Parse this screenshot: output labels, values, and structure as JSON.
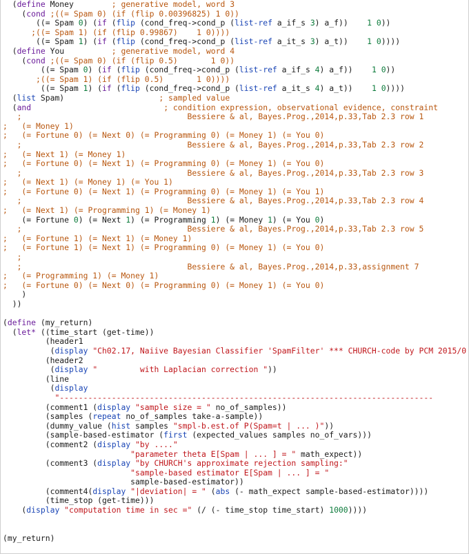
{
  "editor": {
    "colors": {
      "plain": "#1a1a1a",
      "keyword": "#6a1b9a",
      "comment": "#b8560e",
      "string": "#c0161b",
      "number": "#0b7a3a",
      "builtin": "#1a45b5"
    },
    "lines": [
      [
        [
          "  (",
          "plain"
        ],
        [
          "define",
          "kw"
        ],
        [
          " Money        ",
          "plain"
        ],
        [
          "; generative model, word 3",
          "com"
        ]
      ],
      [
        [
          "    (",
          "plain"
        ],
        [
          "cond",
          "kw"
        ],
        [
          " ",
          "plain"
        ],
        [
          ";((= Spam 0) (if (flip 0.00396825) 1 0))",
          "com"
        ]
      ],
      [
        [
          "       ((= Spam ",
          "plain"
        ],
        [
          "0",
          "num"
        ],
        [
          ") (",
          "plain"
        ],
        [
          "if",
          "kw"
        ],
        [
          " (",
          "plain"
        ],
        [
          "flip",
          "fn"
        ],
        [
          " (cond_freq->cond_p (",
          "plain"
        ],
        [
          "list-ref",
          "fn"
        ],
        [
          " a_if_s ",
          "plain"
        ],
        [
          "3",
          "num"
        ],
        [
          ") a_f))    ",
          "plain"
        ],
        [
          "1",
          "num"
        ],
        [
          " ",
          "plain"
        ],
        [
          "0",
          "num"
        ],
        [
          "))",
          "plain"
        ]
      ],
      [
        [
          "      ",
          "plain"
        ],
        [
          ";((= Spam 1) (if (flip 0.99867)    1 0))))",
          "com"
        ]
      ],
      [
        [
          "       ((= Spam ",
          "plain"
        ],
        [
          "1",
          "num"
        ],
        [
          ") (",
          "plain"
        ],
        [
          "if",
          "kw"
        ],
        [
          " (",
          "plain"
        ],
        [
          "flip",
          "fn"
        ],
        [
          " (cond_freq->cond_p (",
          "plain"
        ],
        [
          "list-ref",
          "fn"
        ],
        [
          " a_it_s ",
          "plain"
        ],
        [
          "3",
          "num"
        ],
        [
          ") a_t))    ",
          "plain"
        ],
        [
          "1",
          "num"
        ],
        [
          " ",
          "plain"
        ],
        [
          "0",
          "num"
        ],
        [
          "))))",
          "plain"
        ]
      ],
      [
        [
          "  (",
          "plain"
        ],
        [
          "define",
          "kw"
        ],
        [
          " You          ",
          "plain"
        ],
        [
          "; generative model, word 4",
          "com"
        ]
      ],
      [
        [
          "    (",
          "plain"
        ],
        [
          "cond",
          "kw"
        ],
        [
          " ",
          "plain"
        ],
        [
          ";((= Spam 0) (if (flip 0.5)       1 0))",
          "com"
        ]
      ],
      [
        [
          "        ((= Spam ",
          "plain"
        ],
        [
          "0",
          "num"
        ],
        [
          ") (",
          "plain"
        ],
        [
          "if",
          "kw"
        ],
        [
          " (",
          "plain"
        ],
        [
          "flip",
          "fn"
        ],
        [
          " (cond_freq->cond_p (",
          "plain"
        ],
        [
          "list-ref",
          "fn"
        ],
        [
          " a_if_s ",
          "plain"
        ],
        [
          "4",
          "num"
        ],
        [
          ") a_f))    ",
          "plain"
        ],
        [
          "1",
          "num"
        ],
        [
          " ",
          "plain"
        ],
        [
          "0",
          "num"
        ],
        [
          "))",
          "plain"
        ]
      ],
      [
        [
          "       ",
          "plain"
        ],
        [
          ";((= Spam 1) (if (flip 0.5)       1 0))))",
          "com"
        ]
      ],
      [
        [
          "        ((= Spam ",
          "plain"
        ],
        [
          "1",
          "num"
        ],
        [
          ") (",
          "plain"
        ],
        [
          "if",
          "kw"
        ],
        [
          " (",
          "plain"
        ],
        [
          "flip",
          "fn"
        ],
        [
          " (cond_freq->cond_p (",
          "plain"
        ],
        [
          "list-ref",
          "fn"
        ],
        [
          " a_it_s ",
          "plain"
        ],
        [
          "4",
          "num"
        ],
        [
          ") a_t))    ",
          "plain"
        ],
        [
          "1",
          "num"
        ],
        [
          " ",
          "plain"
        ],
        [
          "0",
          "num"
        ],
        [
          "))))",
          "plain"
        ]
      ],
      [
        [
          "  (",
          "plain"
        ],
        [
          "list",
          "fn"
        ],
        [
          " Spam)                    ",
          "plain"
        ],
        [
          "; sampled value",
          "com"
        ]
      ],
      [
        [
          "  (",
          "plain"
        ],
        [
          "and",
          "kw"
        ],
        [
          "                            ",
          "plain"
        ],
        [
          "; condition expression, observational evidence, constraint",
          "com"
        ]
      ],
      [
        [
          "   ",
          "plain"
        ],
        [
          ";                                   Bessiere & al, Bayes.Prog.,2014,p.33,Tab 2.3 row 1",
          "com"
        ]
      ],
      [
        [
          ";   (= Money 1)",
          "com"
        ]
      ],
      [
        [
          ";   (= Fortune 0) (= Next 0) (= Programming 0) (= Money 1) (= You 0)",
          "com"
        ]
      ],
      [
        [
          "   ",
          "plain"
        ],
        [
          ";                                   Bessiere & al, Bayes.Prog.,2014,p.33,Tab 2.3 row 2",
          "com"
        ]
      ],
      [
        [
          ";   (= Next 1) (= Money 1)",
          "com"
        ]
      ],
      [
        [
          ";   (= Fortune 0) (= Next 1) (= Programming 0) (= Money 1) (= You 0)",
          "com"
        ]
      ],
      [
        [
          "   ",
          "plain"
        ],
        [
          ";                                   Bessiere & al, Bayes.Prog.,2014,p.33,Tab 2.3 row 3",
          "com"
        ]
      ],
      [
        [
          ";   (= Next 1) (= Money 1) (= You 1)",
          "com"
        ]
      ],
      [
        [
          ";   (= Fortune 0) (= Next 1) (= Programming 0) (= Money 1) (= You 1)",
          "com"
        ]
      ],
      [
        [
          "   ",
          "plain"
        ],
        [
          ";                                   Bessiere & al, Bayes.Prog.,2014,p.33,Tab 2.3 row 4",
          "com"
        ]
      ],
      [
        [
          ";   (= Next 1) (= Programming 1) (= Money 1)",
          "com"
        ]
      ],
      [
        [
          "    (= Fortune ",
          "plain"
        ],
        [
          "0",
          "num"
        ],
        [
          ") (= Next ",
          "plain"
        ],
        [
          "1",
          "num"
        ],
        [
          ") (= Programming ",
          "plain"
        ],
        [
          "1",
          "num"
        ],
        [
          ") (= Money ",
          "plain"
        ],
        [
          "1",
          "num"
        ],
        [
          ") (= You ",
          "plain"
        ],
        [
          "0",
          "num"
        ],
        [
          ")",
          "plain"
        ]
      ],
      [
        [
          "   ",
          "plain"
        ],
        [
          ";                                   Bessiere & al, Bayes.Prog.,2014,p.33,Tab 2.3 row 5",
          "com"
        ]
      ],
      [
        [
          ";   (= Fortune 1) (= Next 1) (= Money 1)",
          "com"
        ]
      ],
      [
        [
          ";   (= Fortune 1) (= Next 1) (= Programming 0) (= Money 1) (= You 0)",
          "com"
        ]
      ],
      [
        [
          "   ",
          "plain"
        ],
        [
          ";",
          "com"
        ]
      ],
      [
        [
          "   ",
          "plain"
        ],
        [
          ";                                   Bessiere & al, Bayes.Prog.,2014,p.33,assignment 7",
          "com"
        ]
      ],
      [
        [
          ";   (= Programming 1) (= Money 1)",
          "com"
        ]
      ],
      [
        [
          ";   (= Fortune 0) (= Next 0) (= Programming 0) (= Money 1) (= You 0)",
          "com"
        ]
      ],
      [
        [
          "    )",
          "plain"
        ]
      ],
      [
        [
          "  ))",
          "plain"
        ]
      ],
      [
        [
          "",
          "plain"
        ]
      ],
      [
        [
          "(",
          "plain"
        ],
        [
          "define",
          "kw"
        ],
        [
          " (my_return)",
          "plain"
        ]
      ],
      [
        [
          "  (",
          "plain"
        ],
        [
          "let*",
          "kw"
        ],
        [
          " ((time_start (get-time))",
          "plain"
        ]
      ],
      [
        [
          "         (header1",
          "plain"
        ]
      ],
      [
        [
          "          (",
          "plain"
        ],
        [
          "display",
          "fn"
        ],
        [
          " ",
          "plain"
        ],
        [
          "\"Ch02.17, Naiive Bayesian Classifier 'SpamFilter' *** CHURCH-code by PCM 2015/0",
          "str"
        ]
      ],
      [
        [
          "         (header2",
          "plain"
        ]
      ],
      [
        [
          "          (",
          "plain"
        ],
        [
          "display",
          "fn"
        ],
        [
          " ",
          "plain"
        ],
        [
          "\"         with Laplacian correction \"",
          "str"
        ],
        [
          "))",
          "plain"
        ]
      ],
      [
        [
          "         (line",
          "plain"
        ]
      ],
      [
        [
          "          (",
          "plain"
        ],
        [
          "display",
          "fn"
        ]
      ],
      [
        [
          "           ",
          "plain"
        ],
        [
          "\"-------------------------------------------------------------------------------",
          "str"
        ]
      ],
      [
        [
          "         (comment1 (",
          "plain"
        ],
        [
          "display",
          "fn"
        ],
        [
          " ",
          "plain"
        ],
        [
          "\"sample size = \"",
          "str"
        ],
        [
          " no_of_samples))",
          "plain"
        ]
      ],
      [
        [
          "         (samples (",
          "plain"
        ],
        [
          "repeat",
          "fn"
        ],
        [
          " no_of_samples take-a-sample))",
          "plain"
        ]
      ],
      [
        [
          "         (dummy_value (",
          "plain"
        ],
        [
          "hist",
          "fn"
        ],
        [
          " samples ",
          "plain"
        ],
        [
          "\"smpl-b.est.of P(Spam=t | ... )\"",
          "str"
        ],
        [
          "))",
          "plain"
        ]
      ],
      [
        [
          "         (sample-based-estimator (",
          "plain"
        ],
        [
          "first",
          "fn"
        ],
        [
          " (expected_values samples no_of_vars)))",
          "plain"
        ]
      ],
      [
        [
          "         (comment2 (",
          "plain"
        ],
        [
          "display",
          "fn"
        ],
        [
          " ",
          "plain"
        ],
        [
          "\"by ....\"",
          "str"
        ]
      ],
      [
        [
          "                           ",
          "plain"
        ],
        [
          "\"parameter theta E[Spam | ... ] = \"",
          "str"
        ],
        [
          " math_expect))",
          "plain"
        ]
      ],
      [
        [
          "         (comment3 (",
          "plain"
        ],
        [
          "display",
          "fn"
        ],
        [
          " ",
          "plain"
        ],
        [
          "\"by CHURCH's approximate rejection sampling:\"",
          "str"
        ]
      ],
      [
        [
          "                           ",
          "plain"
        ],
        [
          "\"sample-based estimator E[Spam | ... ] = \"",
          "str"
        ]
      ],
      [
        [
          "                           sample-based-estimator))",
          "plain"
        ]
      ],
      [
        [
          "         (comment4(",
          "plain"
        ],
        [
          "display",
          "fn"
        ],
        [
          " ",
          "plain"
        ],
        [
          "\"|deviation| = \"",
          "str"
        ],
        [
          " (",
          "plain"
        ],
        [
          "abs",
          "fn"
        ],
        [
          " (- math_expect sample-based-estimator))))",
          "plain"
        ]
      ],
      [
        [
          "         (time_stop (get-time)))",
          "plain"
        ]
      ],
      [
        [
          "    (",
          "plain"
        ],
        [
          "display",
          "fn"
        ],
        [
          " ",
          "plain"
        ],
        [
          "\"computation time in sec =\"",
          "str"
        ],
        [
          " (/ (- time_stop time_start) ",
          "plain"
        ],
        [
          "1000",
          "num"
        ],
        [
          "))))",
          "plain"
        ]
      ],
      [
        [
          "",
          "plain"
        ]
      ],
      [
        [
          "",
          "plain"
        ]
      ],
      [
        [
          "(my_return)",
          "plain"
        ]
      ],
      [
        [
          "",
          "plain"
        ]
      ],
      [
        [
          ";------------------------------------------------------------------------------------",
          "com"
        ]
      ]
    ]
  }
}
